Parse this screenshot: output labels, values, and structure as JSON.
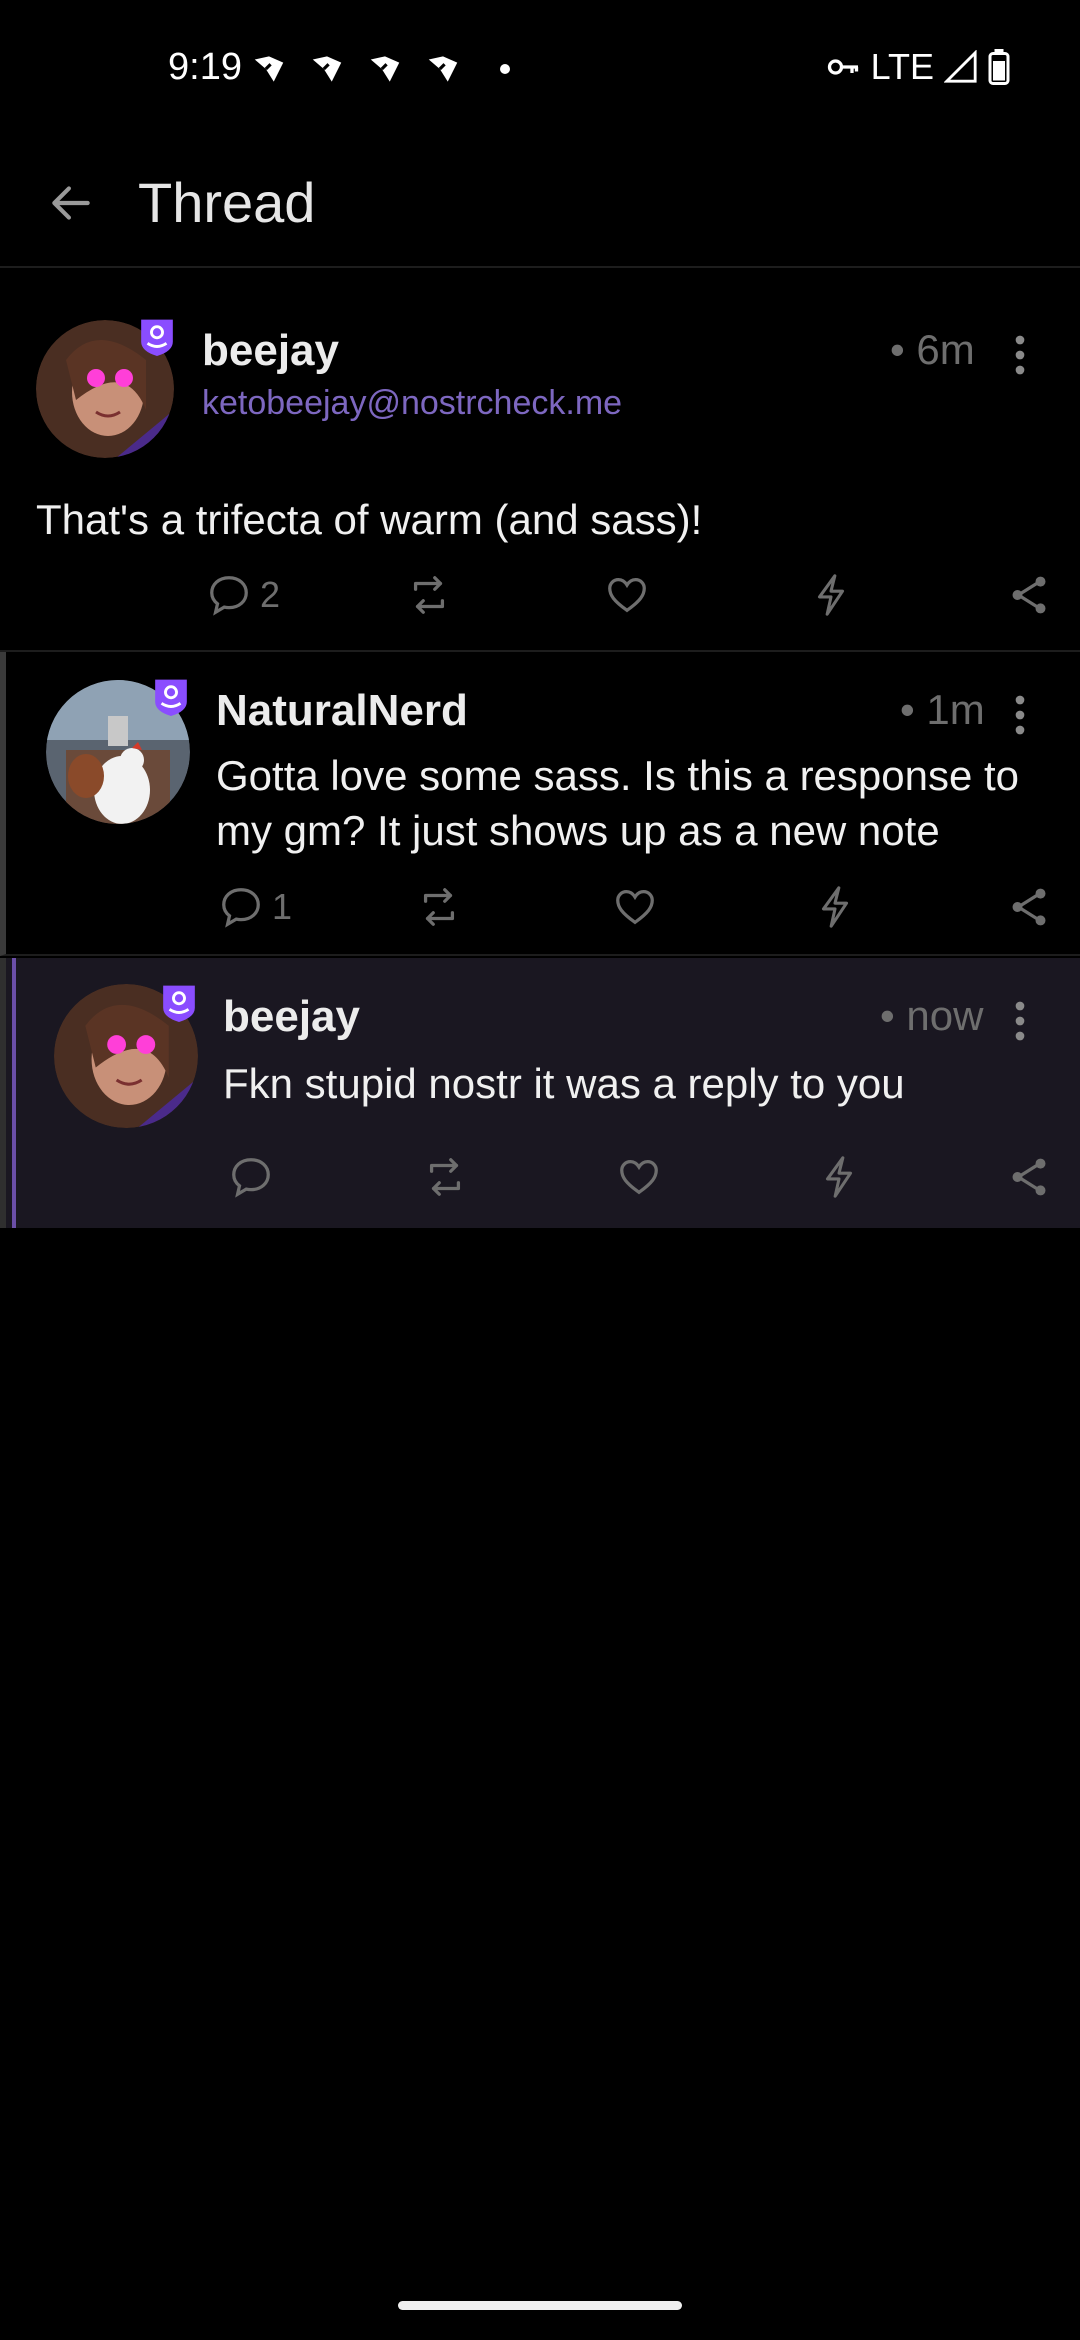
{
  "status_bar": {
    "time": "9:19",
    "network": "LTE"
  },
  "toolbar": {
    "title": "Thread"
  },
  "notes": [
    {
      "author": "beejay",
      "nip05": "ketobeejay@nostrcheck.me",
      "time": "• 6m",
      "content": "That's a trifecta of warm (and sass)!",
      "reply_count": "2"
    },
    {
      "author": "NaturalNerd",
      "time": "• 1m",
      "content": "Gotta love some sass. Is this a response to my gm? It just shows up as a new note",
      "reply_count": "1"
    },
    {
      "author": "beejay",
      "time": "• now",
      "content": "Fkn stupid nostr it was a reply to you",
      "reply_count": ""
    }
  ],
  "colors": {
    "accent": "#7d67c0",
    "badge": "#8a4dff",
    "muted": "#6e6e6e",
    "highlight_bg": "#1a1721"
  }
}
